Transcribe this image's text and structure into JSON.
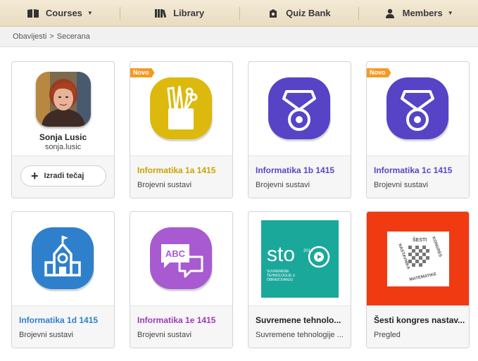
{
  "nav": [
    {
      "label": "Courses",
      "icon": "book-icon",
      "caret": true
    },
    {
      "label": "Library",
      "icon": "library-icon",
      "caret": false
    },
    {
      "label": "Quiz Bank",
      "icon": "quiz-icon",
      "caret": false
    },
    {
      "label": "Members",
      "icon": "user-icon",
      "caret": true
    }
  ],
  "breadcrumb": {
    "root": "Obavijesti",
    "sep": ">",
    "current": "Secerana"
  },
  "profile": {
    "name": "Sonja Lusic",
    "username": "sonja.lusic",
    "create_label": "Izradi tečaj"
  },
  "badge_label": "Novo",
  "courses": [
    {
      "title": "Informatika 1a 1415",
      "sub": "Brojevni sustavi",
      "title_color": "#c8a400",
      "badge": true,
      "icon": "pencil-cup-icon"
    },
    {
      "title": "Informatika 1b 1415",
      "sub": "Brojevni sustavi",
      "title_color": "#5a45c8",
      "badge": false,
      "icon": "medal-icon"
    },
    {
      "title": "Informatika 1c 1415",
      "sub": "Brojevni sustavi",
      "title_color": "#5a45c8",
      "badge": true,
      "icon": "medal-icon"
    },
    {
      "title": "Informatika 1d 1415",
      "sub": "Brojevni sustavi",
      "title_color": "#2f7fcc",
      "badge": false,
      "icon": "school-icon"
    },
    {
      "title": "Informatika 1e 1415",
      "sub": "Brojevni sustavi",
      "title_color": "#9b3cb4",
      "badge": false,
      "icon": "chat-abc-icon"
    },
    {
      "title": "Suvremene tehnolo...",
      "sub": "Suvremene tehnologije ...",
      "title_color": "#222222",
      "badge": false,
      "icon": "sto-logo"
    },
    {
      "title": "Šesti kongres nastav...",
      "sub": "Pregled",
      "title_color": "#222222",
      "badge": false,
      "icon": "kongres-logo"
    }
  ],
  "logos": {
    "sto_text": "sto",
    "sto_year": "2014",
    "sto_caption_1": "SUVREMENE",
    "sto_caption_2": "TEHNOLOGIJE U",
    "sto_caption_3": "OBRAZOVANJU",
    "k_top": "ŠESTI",
    "k_left": "NASTAVNIKA",
    "k_right": "KONGRES",
    "k_bottom": "MATEMATIKE"
  },
  "colors": {
    "yellow": "#dcb90c",
    "purple": "#5743c6",
    "blue": "#2f80cc",
    "violet": "#a85bd1",
    "teal": "#1aa89a",
    "red": "#f03a12"
  }
}
